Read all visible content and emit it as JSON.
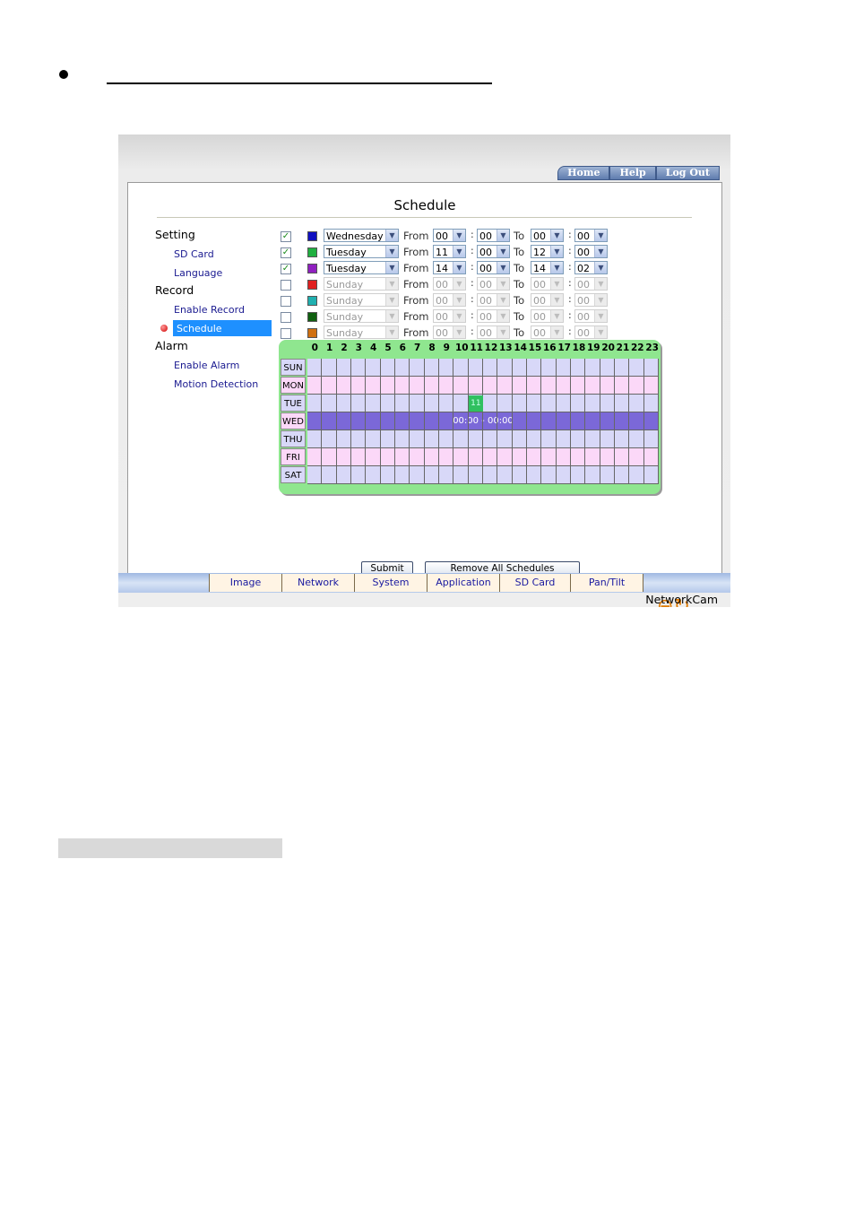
{
  "app_title": "Schedule",
  "top_nav": [
    "Home",
    "Help",
    "Log Out"
  ],
  "menu": {
    "setting": "Setting",
    "sd_card": "SD Card",
    "language": "Language",
    "record": "Record",
    "enable_record": "Enable Record",
    "schedule": "Schedule",
    "alarm": "Alarm",
    "enable_alarm": "Enable Alarm",
    "motion_detection": "Motion Detection"
  },
  "labels": {
    "from": "From",
    "to": "To",
    "colon": ":"
  },
  "schedules": [
    {
      "checked": true,
      "color": "#1010c0",
      "day": "Wednesday",
      "from_h": "00",
      "from_m": "00",
      "to_h": "00",
      "to_m": "00",
      "enabled": true
    },
    {
      "checked": true,
      "color": "#20b040",
      "day": "Tuesday",
      "from_h": "11",
      "from_m": "00",
      "to_h": "12",
      "to_m": "00",
      "enabled": true
    },
    {
      "checked": true,
      "color": "#9020c0",
      "day": "Tuesday",
      "from_h": "14",
      "from_m": "00",
      "to_h": "14",
      "to_m": "02",
      "enabled": true
    },
    {
      "checked": false,
      "color": "#e02020",
      "day": "Sunday",
      "from_h": "00",
      "from_m": "00",
      "to_h": "00",
      "to_m": "00",
      "enabled": false
    },
    {
      "checked": false,
      "color": "#20b0b0",
      "day": "Sunday",
      "from_h": "00",
      "from_m": "00",
      "to_h": "00",
      "to_m": "00",
      "enabled": false
    },
    {
      "checked": false,
      "color": "#106010",
      "day": "Sunday",
      "from_h": "00",
      "from_m": "00",
      "to_h": "00",
      "to_m": "00",
      "enabled": false
    },
    {
      "checked": false,
      "color": "#d07010",
      "day": "Sunday",
      "from_h": "00",
      "from_m": "00",
      "to_h": "00",
      "to_m": "00",
      "enabled": false
    }
  ],
  "grid": {
    "hours": [
      "0",
      "1",
      "2",
      "3",
      "4",
      "5",
      "6",
      "7",
      "8",
      "9",
      "10",
      "11",
      "12",
      "13",
      "14",
      "15",
      "16",
      "17",
      "18",
      "19",
      "20",
      "21",
      "22",
      "23"
    ],
    "days": [
      "SUN",
      "MON",
      "TUE",
      "WED",
      "THU",
      "FRI",
      "SAT"
    ],
    "wed_bar_label": "00:00 - 00:00",
    "tue_marker": "11",
    "colors": {
      "odd_row": "#d8d8f8",
      "even_row": "#fbd8f8",
      "wed": "#7b68d8",
      "tue_block": "#30c060"
    }
  },
  "buttons": {
    "submit": "Submit",
    "remove_all": "Remove All Schedules"
  },
  "bottom_nav": [
    "Image",
    "Network",
    "System",
    "Application",
    "SD Card",
    "Pan/Tilt"
  ],
  "brand": "NetworkCam"
}
